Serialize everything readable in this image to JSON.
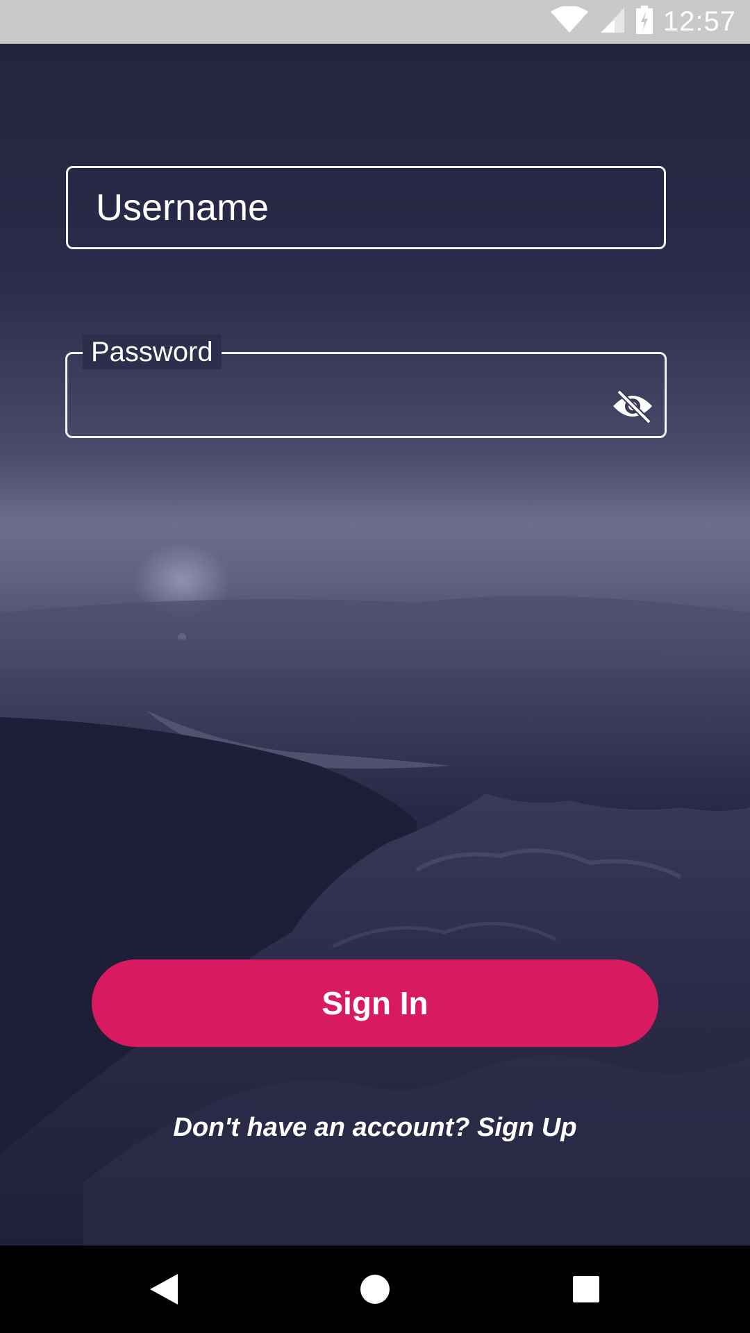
{
  "status_bar": {
    "time": "12:57",
    "icons": [
      "wifi-icon",
      "cell-signal-icon",
      "battery-charging-icon"
    ]
  },
  "form": {
    "username_value": "Username",
    "password_label": "Password",
    "password_value": "",
    "password_toggle_icon": "eye-off-icon"
  },
  "actions": {
    "sign_in_label": "Sign In",
    "sign_up_prompt": "Don't have an account? Sign Up"
  },
  "nav_bar": {
    "icons": [
      "back-icon",
      "home-icon",
      "recents-icon"
    ]
  },
  "colors": {
    "accent": "#d81b60",
    "field_border": "#f2f2f7",
    "status_bar": "#c9c9c9",
    "nav_bar": "#000000"
  }
}
